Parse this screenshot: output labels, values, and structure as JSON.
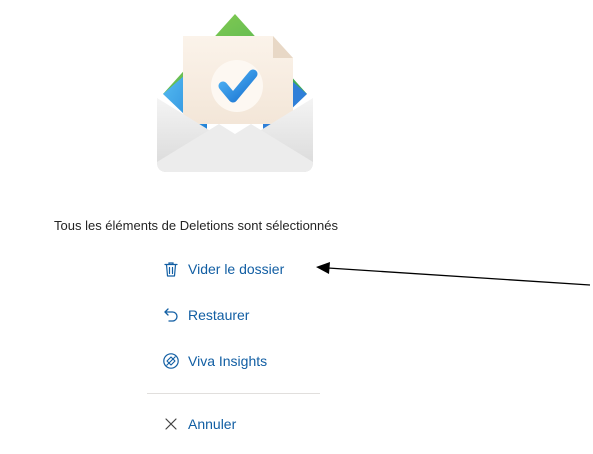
{
  "empty_state": {
    "message": "Tous les éléments de Deletions sont sélectionnés",
    "illustration_icon": "envelope-check-icon"
  },
  "actions": {
    "empty_folder": {
      "label": "Vider le dossier",
      "icon": "trash-icon"
    },
    "restore": {
      "label": "Restaurer",
      "icon": "undo-icon"
    },
    "viva_insights": {
      "label": "Viva Insights",
      "icon": "viva-insights-icon"
    },
    "cancel": {
      "label": "Annuler",
      "icon": "close-icon"
    }
  },
  "colors": {
    "accent": "#115ea3",
    "text": "#242424",
    "divider": "#e1dfdd",
    "check": "#2f8fe6"
  },
  "annotation": {
    "arrow_target": "Vider le dossier"
  }
}
